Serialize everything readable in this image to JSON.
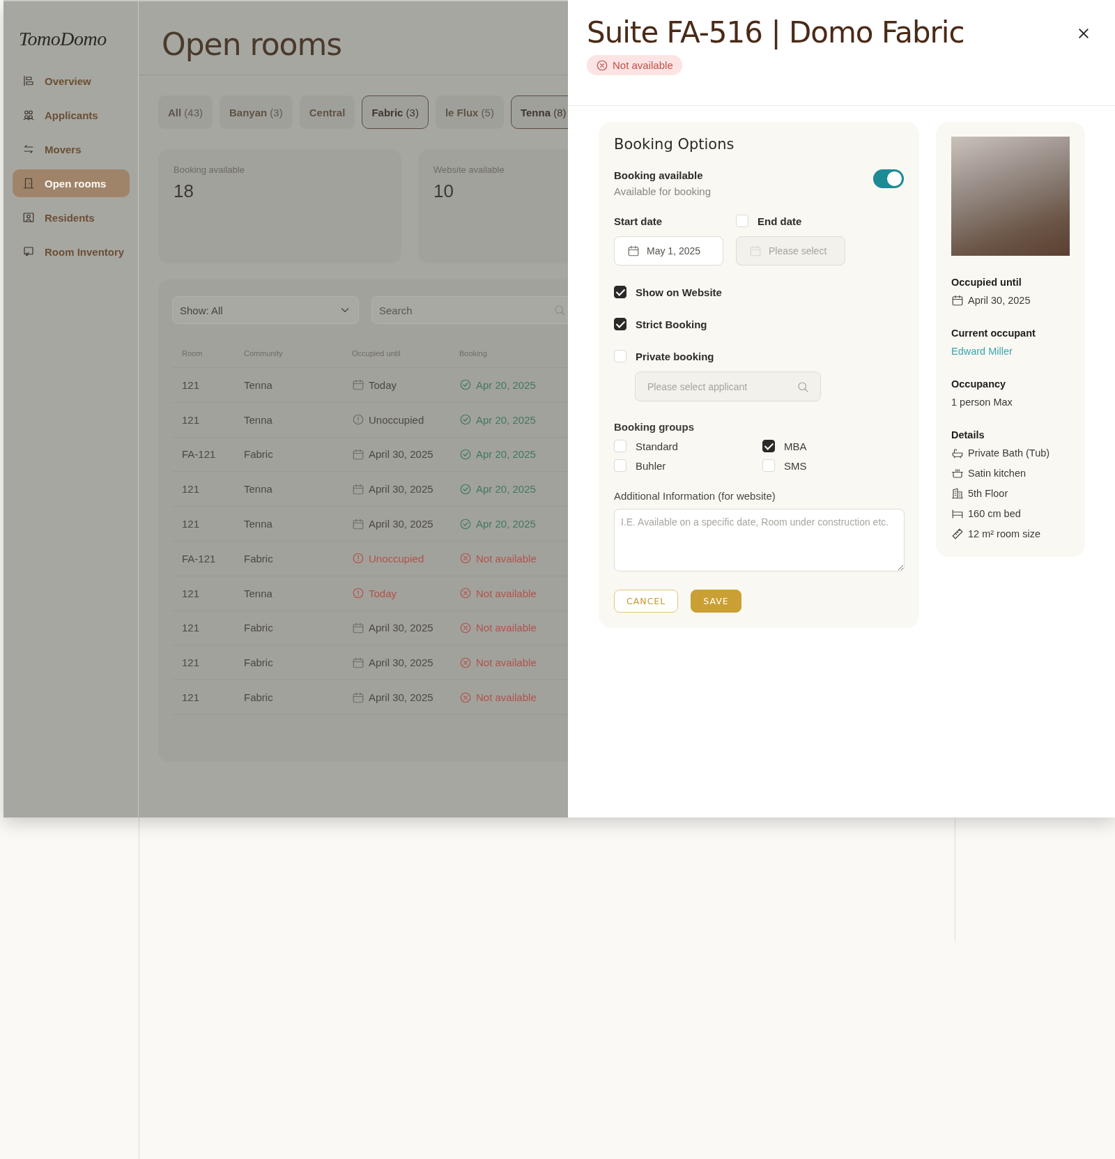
{
  "sidebar": {
    "logo": "TomoDomo",
    "items": [
      {
        "label": "Overview",
        "selected": false
      },
      {
        "label": "Applicants",
        "selected": false
      },
      {
        "label": "Movers",
        "selected": false
      },
      {
        "label": "Open rooms",
        "selected": true
      },
      {
        "label": "Residents",
        "selected": false
      },
      {
        "label": "Room Inventory",
        "selected": false
      }
    ]
  },
  "page": {
    "title": "Open rooms"
  },
  "filters": [
    {
      "label": "All",
      "count": "(43)",
      "selected": false
    },
    {
      "label": "Banyan",
      "count": "(3)",
      "selected": false
    },
    {
      "label": "Central",
      "selected": false
    },
    {
      "label": "Fabric",
      "count": "(3)",
      "selected": true
    },
    {
      "label": "le Flux",
      "count": "(5)",
      "selected": false
    },
    {
      "label": "Tenna",
      "count": "(8)",
      "selected": true
    }
  ],
  "stats": [
    {
      "label": "Booking available",
      "value": "18"
    },
    {
      "label": "Website available",
      "value": "10"
    }
  ],
  "table": {
    "show_select": "Show: All",
    "search_placeholder": "Search",
    "columns": [
      "Room",
      "Community",
      "Occupied until",
      "Booking"
    ],
    "rows": [
      {
        "room": "121",
        "community": "Tenna",
        "occupied_until": "Today",
        "occupied_alert": false,
        "occupied_overdue": false,
        "booking": "Apr 20, 2025",
        "booking_available": true
      },
      {
        "room": "121",
        "community": "Tenna",
        "occupied_until": "Unoccupied",
        "occupied_alert": true,
        "occupied_overdue": false,
        "booking": "Apr 20, 2025",
        "booking_available": true
      },
      {
        "room": "FA-121",
        "community": "Fabric",
        "occupied_until": "April 30, 2025",
        "occupied_alert": false,
        "occupied_overdue": false,
        "booking": "Apr 20, 2025",
        "booking_available": true
      },
      {
        "room": "121",
        "community": "Tenna",
        "occupied_until": "April 30, 2025",
        "occupied_alert": false,
        "occupied_overdue": false,
        "booking": "Apr 20, 2025",
        "booking_available": true
      },
      {
        "room": "121",
        "community": "Tenna",
        "occupied_until": "April 30, 2025",
        "occupied_alert": false,
        "occupied_overdue": false,
        "booking": "Apr 20, 2025",
        "booking_available": true
      },
      {
        "room": "FA-121",
        "community": "Fabric",
        "occupied_until": "Unoccupied",
        "occupied_alert": true,
        "occupied_overdue": true,
        "booking": "Not available",
        "booking_available": false
      },
      {
        "room": "121",
        "community": "Tenna",
        "occupied_until": "Today",
        "occupied_alert": true,
        "occupied_overdue": true,
        "booking": "Not available",
        "booking_available": false
      },
      {
        "room": "121",
        "community": "Fabric",
        "occupied_until": "April 30, 2025",
        "occupied_alert": false,
        "occupied_overdue": false,
        "booking": "Not available",
        "booking_available": false
      },
      {
        "room": "121",
        "community": "Fabric",
        "occupied_until": "April 30, 2025",
        "occupied_alert": false,
        "occupied_overdue": false,
        "booking": "Not available",
        "booking_available": false
      },
      {
        "room": "121",
        "community": "Fabric",
        "occupied_until": "April 30, 2025",
        "occupied_alert": false,
        "occupied_overdue": false,
        "booking": "Not available",
        "booking_available": false
      }
    ]
  },
  "drawer": {
    "title": "Suite FA-516 | Domo Fabric",
    "status": {
      "label": "Not available",
      "available": false
    },
    "booking_options": {
      "title": "Booking Options",
      "toggle": {
        "label": "Booking available",
        "hint": "Available for booking",
        "on": true
      },
      "start_date": {
        "label": "Start date",
        "value": "May 1, 2025"
      },
      "end_date": {
        "label": "End date",
        "checked": false,
        "placeholder": "Please select",
        "disabled": true
      },
      "checks": [
        {
          "label": "Show on Website",
          "checked": true
        },
        {
          "label": "Strict Booking",
          "checked": true
        },
        {
          "label": "Private booking",
          "checked": false
        }
      ],
      "applicant": {
        "placeholder": "Please select applicant",
        "disabled": true
      },
      "groups": {
        "title": "Booking groups",
        "options": [
          {
            "label": "Standard",
            "checked": false
          },
          {
            "label": "MBA",
            "checked": true
          },
          {
            "label": "Buhler",
            "checked": false
          },
          {
            "label": "SMS",
            "checked": false
          }
        ]
      },
      "additional": {
        "label": "Additional Information (for website)",
        "placeholder": "I.E. Available on a specific date, Room under construction etc."
      },
      "buttons": [
        {
          "label": "CANCEL",
          "kind": "secondary"
        },
        {
          "label": "SAVE",
          "kind": "primary"
        }
      ]
    },
    "room": {
      "sections": [
        {
          "label": "Occupied until",
          "kind": "date",
          "value": "April 30, 2025"
        },
        {
          "label": "Current occupant",
          "kind": "link",
          "value": "Edward Miller"
        },
        {
          "label": "Occupancy",
          "kind": "text",
          "value": "1 person Max"
        }
      ],
      "details": {
        "label": "Details",
        "items": [
          "Private Bath (Tub)",
          "Satin kitchen",
          "5th Floor",
          "160 cm bed",
          "12 m² room size"
        ]
      }
    }
  }
}
